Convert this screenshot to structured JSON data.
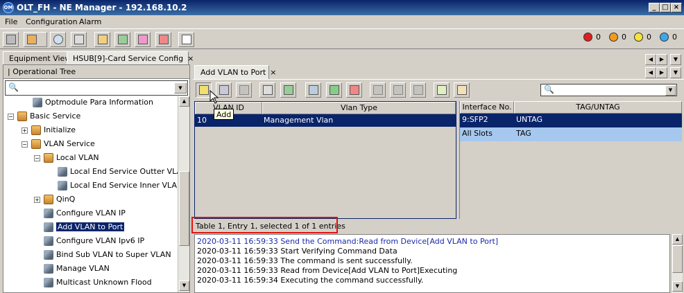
{
  "window": {
    "title": "OLT_FH - NE Manager - 192.168.10.2"
  },
  "menu": [
    "File",
    "Configuration",
    "Alarm"
  ],
  "alarms": [
    {
      "color": "#e02020",
      "count": "0"
    },
    {
      "color": "#f39a1e",
      "count": "0"
    },
    {
      "color": "#f5e23a",
      "count": "0"
    },
    {
      "color": "#3ea6ea",
      "count": "0"
    }
  ],
  "main_tabs": [
    "Equipment View",
    "HSUB[9]-Card Service Config"
  ],
  "tree": {
    "header": "Operational Tree",
    "items": [
      {
        "label": "Optmodule Para Information"
      },
      {
        "label": "Basic Service"
      },
      {
        "label": "Initialize"
      },
      {
        "label": "VLAN Service"
      },
      {
        "label": "Local VLAN"
      },
      {
        "label": "Local End Service Outter VLAN"
      },
      {
        "label": "Local End Service Inner VLAN"
      },
      {
        "label": "QinQ"
      },
      {
        "label": "Configure VLAN IP"
      },
      {
        "label": "Add VLAN to Port"
      },
      {
        "label": "Configure VLAN Ipv6 IP"
      },
      {
        "label": "Bind Sub VLAN to Super VLAN"
      },
      {
        "label": "Manage VLAN"
      },
      {
        "label": "Multicast Unknown Flood"
      }
    ]
  },
  "sub_tab": "Add VLAN to Port",
  "tooltip": "Add",
  "left_table": {
    "columns": [
      "VLAN ID",
      "Vlan Type"
    ],
    "rows": [
      [
        "10",
        "Management Vlan"
      ]
    ]
  },
  "right_table": {
    "columns": [
      "Interface No.",
      "TAG/UNTAG"
    ],
    "rows": [
      [
        "9:SFP2",
        "UNTAG"
      ],
      [
        "All Slots",
        "TAG"
      ]
    ]
  },
  "status": "Table 1, Entry 1, selected 1 of 1 entries",
  "log": [
    {
      "text": "2020-03-11 16:59:33 Send the Command:Read from Device[Add VLAN to Port]",
      "color": "#1a2aa8"
    },
    {
      "text": "2020-03-11 16:59:33 Start Verifying Command Data",
      "color": "#000000"
    },
    {
      "text": "2020-03-11 16:59:33 The command is sent successfully.",
      "color": "#000000"
    },
    {
      "text": "2020-03-11 16:59:33 Read from Device[Add VLAN to Port]Executing",
      "color": "#000000"
    },
    {
      "text": "2020-03-11 16:59:34 Executing the command successfully.",
      "color": "#000000"
    }
  ]
}
